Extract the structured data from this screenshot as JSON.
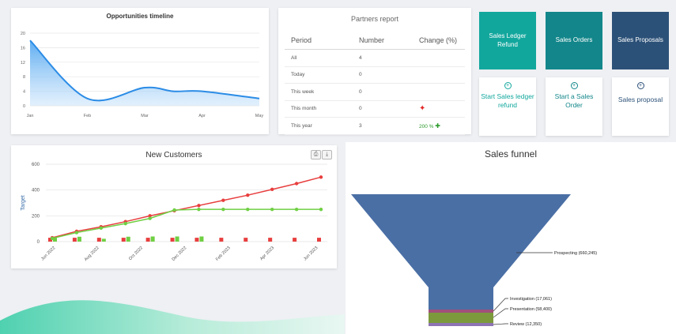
{
  "opportunities": {
    "title": "Opportunities timeline",
    "chart_data": {
      "type": "area",
      "categories": [
        "Jan",
        "Feb",
        "Mar",
        "Apr",
        "May"
      ],
      "x": [
        0,
        0.25,
        0.5,
        0.625,
        0.75,
        1
      ],
      "values": [
        18,
        2,
        5,
        4,
        4,
        2
      ],
      "y_ticks": [
        0,
        4,
        8,
        12,
        16,
        20
      ],
      "ylim": [
        0,
        20
      ],
      "color": "#2b8ce6"
    }
  },
  "partners": {
    "title": "Partners report",
    "headers": [
      "Period",
      "Number",
      "Change (%)"
    ],
    "rows": [
      {
        "period": "All",
        "number": "4",
        "change": ""
      },
      {
        "period": "Today",
        "number": "0",
        "change": ""
      },
      {
        "period": "This week",
        "number": "0",
        "change": ""
      },
      {
        "period": "This month",
        "number": "0",
        "change": ""
      },
      {
        "period": "This year",
        "number": "3",
        "change": "200 %"
      }
    ],
    "up_icon": "arrow-up-icon",
    "down_icon": "arrow-down-icon"
  },
  "tiles": [
    {
      "title": "Sales Ledger Refund",
      "action": "Start Sales ledger refund",
      "color": "#12a79d"
    },
    {
      "title": "Sales Orders",
      "action": "Start a Sales Order",
      "color": "#12868a"
    },
    {
      "title": "Sales Proposals",
      "action": "Sales proposal",
      "color": "#2c5178"
    }
  ],
  "new_customers": {
    "title": "New Customers",
    "ylabel": "Target",
    "chart_data": {
      "type": "line",
      "categories": [
        "Jun 2022",
        "Aug 2022",
        "Oct 2022",
        "Dec 2022",
        "Feb 2023",
        "Apr 2023",
        "Jun 2023"
      ],
      "y_ticks": [
        0,
        200,
        400,
        600
      ],
      "ylim": [
        0,
        600
      ],
      "series": [
        {
          "color": "#e83e3e",
          "values": [
            30,
            80,
            115,
            155,
            200,
            240,
            280,
            320,
            360,
            405,
            450,
            500
          ]
        },
        {
          "color": "#6fcf43",
          "values": [
            25,
            70,
            105,
            140,
            180,
            245,
            250,
            250,
            250,
            250,
            250,
            250
          ]
        },
        {
          "color": "#e83e3e",
          "type": "bar",
          "values": [
            30,
            30,
            30,
            30,
            30,
            30,
            30,
            30,
            30,
            30,
            30,
            30
          ]
        },
        {
          "color": "#6fcf43",
          "type": "bar",
          "values": [
            38,
            38,
            22,
            38,
            40,
            40,
            40,
            0,
            0,
            0,
            0,
            0
          ]
        }
      ]
    }
  },
  "funnel": {
    "title": "Sales funnel",
    "chart_data": {
      "type": "funnel",
      "stages": [
        {
          "name": "Prospecting",
          "value": 660245,
          "label": "Prospecting  (660,245)",
          "color": "#4a6fa5"
        },
        {
          "name": "Investigation",
          "value": 17061,
          "label": "Investigation  (17,061)",
          "color": "#a0507a"
        },
        {
          "name": "Presentation",
          "value": 58400,
          "label": "Presentation  (58,400)",
          "color": "#7c9a3c"
        },
        {
          "name": "Review",
          "value": 12350,
          "label": "Review  (12,350)",
          "color": "#8e74b3"
        }
      ]
    }
  }
}
